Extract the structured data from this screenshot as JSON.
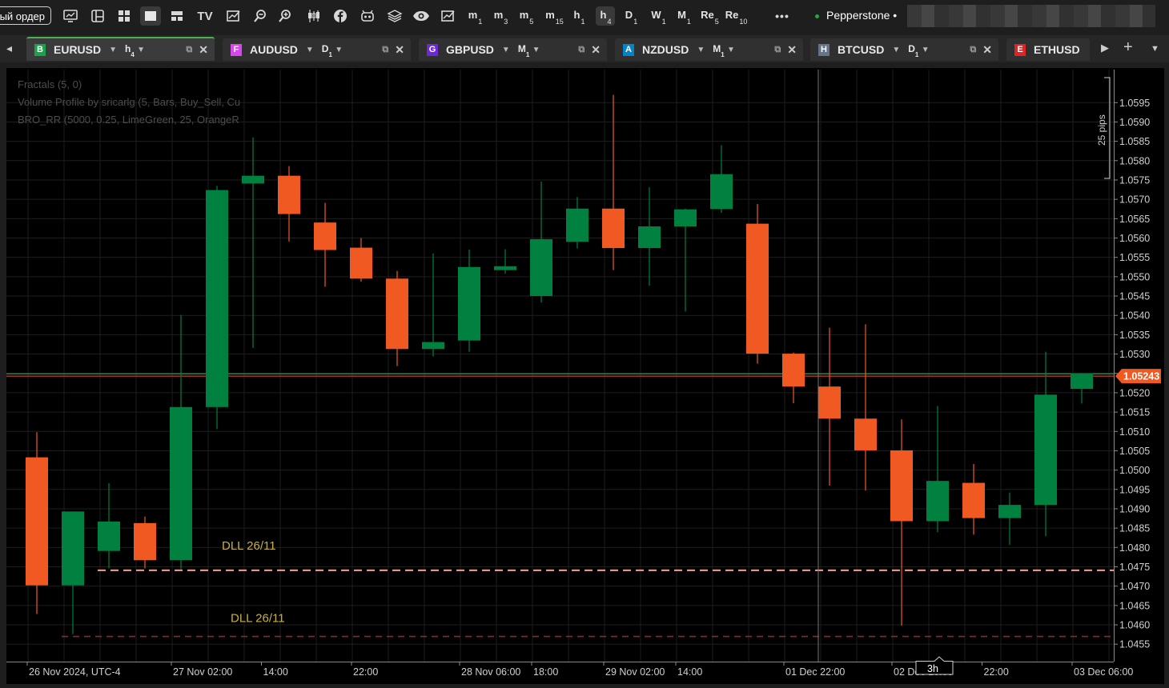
{
  "toolbar": {
    "order_button": "ый ордер",
    "tv": "TV",
    "timeframes": [
      {
        "main": "m",
        "sub": "1"
      },
      {
        "main": "m",
        "sub": "3"
      },
      {
        "main": "m",
        "sub": "5"
      },
      {
        "main": "m",
        "sub": "15"
      },
      {
        "main": "h",
        "sub": "1"
      },
      {
        "main": "h",
        "sub": "4",
        "selected": true
      },
      {
        "main": "D",
        "sub": "1"
      },
      {
        "main": "W",
        "sub": "1"
      },
      {
        "main": "M",
        "sub": "1"
      },
      {
        "main": "Re",
        "sub": "5"
      },
      {
        "main": "Re",
        "sub": "10"
      }
    ],
    "more": "•••",
    "broker": "Pepperstone"
  },
  "tabs": [
    {
      "badge": "B",
      "badge_color": "#16a34a",
      "symbol": "EURUSD",
      "tf": "h",
      "tf_sub": "4",
      "active": true
    },
    {
      "badge": "F",
      "badge_color": "#d946ef",
      "symbol": "AUDUSD",
      "tf": "D",
      "tf_sub": "1"
    },
    {
      "badge": "G",
      "badge_color": "#6d28d9",
      "symbol": "GBPUSD",
      "tf": "M",
      "tf_sub": "1"
    },
    {
      "badge": "A",
      "badge_color": "#0284c7",
      "symbol": "NZDUSD",
      "tf": "M",
      "tf_sub": "1"
    },
    {
      "badge": "H",
      "badge_color": "#64748b",
      "symbol": "BTCUSD",
      "tf": "D",
      "tf_sub": "1"
    },
    {
      "badge": "E",
      "badge_color": "#dc2626",
      "symbol": "ETHUSD"
    }
  ],
  "indicators": [
    "Fractals (5, 0)",
    "Volume Profile by sricarlg (5, Bars, Buy_Sell, Cu",
    "BRO_RR (5000, 0.25, LimeGreen, 25, OrangeR"
  ],
  "chart_data": {
    "type": "candlestick",
    "colors": {
      "bull": "#008140",
      "bear": "#f05a22",
      "grid": "#1e1e1e",
      "price_line": "#f05a22"
    },
    "y_ticks": [
      "1.0595",
      "1.0590",
      "1.0585",
      "1.0580",
      "1.0575",
      "1.0570",
      "1.0565",
      "1.0560",
      "1.0555",
      "1.0550",
      "1.0545",
      "1.0540",
      "1.0535",
      "1.0530",
      "1.0525",
      "1.0520",
      "1.0515",
      "1.0510",
      "1.0505",
      "1.0500",
      "1.0495",
      "1.0490",
      "1.0485",
      "1.0480",
      "1.0475",
      "1.0470",
      "1.0465",
      "1.0460",
      "1.0455"
    ],
    "ylim": [
      1.04538,
      1.05994
    ],
    "x_labels": [
      "26 Nov 2024, UTC-4",
      "27 Nov 02:00",
      "14:00",
      "22:00",
      "28 Nov 06:00",
      "18:00",
      "29 Nov 02:00",
      "14:00",
      "01 Dec 22:00",
      "02 Dec 10:00",
      "22:00",
      "03 Dec 06:00"
    ],
    "x_label_bars": [
      1,
      5,
      7.5,
      10,
      13,
      15,
      17,
      19,
      22,
      25,
      27.5,
      30
    ],
    "candles": [
      {
        "o": 1.05033,
        "h": 1.05098,
        "l": 1.04628,
        "c": 1.04702
      },
      {
        "o": 1.04702,
        "h": 1.04893,
        "l": 1.04576,
        "c": 1.04893
      },
      {
        "o": 1.04791,
        "h": 1.04966,
        "l": 1.04746,
        "c": 1.04867
      },
      {
        "o": 1.04863,
        "h": 1.0488,
        "l": 1.04746,
        "c": 1.04767
      },
      {
        "o": 1.04767,
        "h": 1.05401,
        "l": 1.04744,
        "c": 1.05163
      },
      {
        "o": 1.05163,
        "h": 1.05735,
        "l": 1.05106,
        "c": 1.05724
      },
      {
        "o": 1.05741,
        "h": 1.0586,
        "l": 1.05316,
        "c": 1.05761
      },
      {
        "o": 1.05761,
        "h": 1.05786,
        "l": 1.05591,
        "c": 1.05662
      },
      {
        "o": 1.0564,
        "h": 1.05691,
        "l": 1.05474,
        "c": 1.05569
      },
      {
        "o": 1.05575,
        "h": 1.056,
        "l": 1.05487,
        "c": 1.05495
      },
      {
        "o": 1.05495,
        "h": 1.05515,
        "l": 1.05269,
        "c": 1.05313
      },
      {
        "o": 1.05313,
        "h": 1.0556,
        "l": 1.05294,
        "c": 1.05331
      },
      {
        "o": 1.05335,
        "h": 1.0557,
        "l": 1.05306,
        "c": 1.05525
      },
      {
        "o": 1.05517,
        "h": 1.05571,
        "l": 1.05508,
        "c": 1.05527
      },
      {
        "o": 1.0545,
        "h": 1.05746,
        "l": 1.05433,
        "c": 1.05597
      },
      {
        "o": 1.0559,
        "h": 1.05706,
        "l": 1.05573,
        "c": 1.05676
      },
      {
        "o": 1.05676,
        "h": 1.0597,
        "l": 1.05517,
        "c": 1.05574
      },
      {
        "o": 1.05574,
        "h": 1.05731,
        "l": 1.05477,
        "c": 1.0563
      },
      {
        "o": 1.0563,
        "h": 1.05676,
        "l": 1.0541,
        "c": 1.05674
      },
      {
        "o": 1.05675,
        "h": 1.0584,
        "l": 1.05665,
        "c": 1.05765
      },
      {
        "o": 1.05637,
        "h": 1.05688,
        "l": 1.05275,
        "c": 1.05301
      },
      {
        "o": 1.05301,
        "h": 1.05304,
        "l": 1.05173,
        "c": 1.05216
      },
      {
        "o": 1.05216,
        "h": 1.05368,
        "l": 1.0496,
        "c": 1.05133
      },
      {
        "o": 1.05133,
        "h": 1.05377,
        "l": 1.04947,
        "c": 1.05051
      },
      {
        "o": 1.05051,
        "h": 1.05131,
        "l": 1.04598,
        "c": 1.04868
      },
      {
        "o": 1.04868,
        "h": 1.05166,
        "l": 1.0484,
        "c": 1.04972
      },
      {
        "o": 1.04967,
        "h": 1.05016,
        "l": 1.04833,
        "c": 1.04876
      },
      {
        "o": 1.04876,
        "h": 1.04942,
        "l": 1.04807,
        "c": 1.0491
      },
      {
        "o": 1.0491,
        "h": 1.05306,
        "l": 1.04829,
        "c": 1.05195
      },
      {
        "o": 1.0521,
        "h": 1.05251,
        "l": 1.05172,
        "c": 1.0525
      }
    ],
    "current_price": "1.05243",
    "current_value": 1.05243,
    "horizontal_lines": [
      {
        "label": "DLL 26/11",
        "value": 1.04741,
        "color": "#f4a08a",
        "style": "dashed"
      },
      {
        "label": "DLL 26/11",
        "value": 1.0457,
        "color": "#8b2a2a",
        "style": "dashed"
      }
    ],
    "green_line_value": 1.05249,
    "crosshair_bar": 22,
    "ruler_label": "25 pips",
    "bar_tooltip": "3h"
  }
}
